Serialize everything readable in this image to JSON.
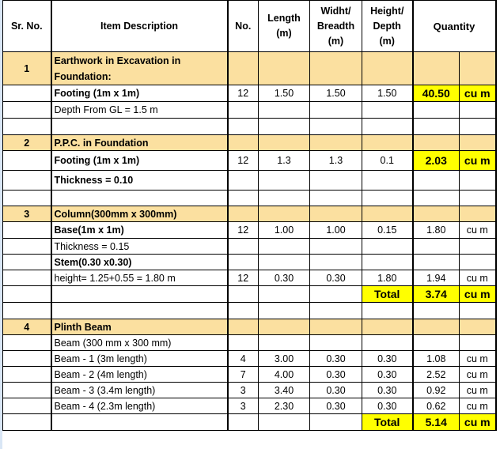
{
  "header": {
    "sr_no": "Sr. No.",
    "item_description": "Item Description",
    "no": "No.",
    "length": "Length (m)",
    "width": "Widht/ Breadth (m)",
    "height": "Height/ Depth (m)",
    "quantity": "Quantity"
  },
  "colors": {
    "section_fill": "#fbe0a0",
    "highlight": "#ffff00"
  },
  "sections": [
    {
      "sr": "1",
      "title": "Earthwork in Excavation in Foundation:",
      "rows": [
        {
          "desc": "Footing (1m x 1m)",
          "bold": true,
          "no": "12",
          "length": "1.50",
          "width": "1.50",
          "height": "1.50",
          "qty": "40.50",
          "unit": "cu m",
          "highlight": true
        },
        {
          "desc": "Depth From GL = 1.5 m",
          "bold": false,
          "no": "",
          "length": "",
          "width": "",
          "height": "",
          "qty": "",
          "unit": ""
        }
      ]
    },
    {
      "sr": "2",
      "title": "P.P.C. in Foundation",
      "rows": [
        {
          "desc": "Footing (1m x 1m)",
          "bold": true,
          "no": "12",
          "length": "1.3",
          "width": "1.3",
          "height": "0.1",
          "qty": "2.03",
          "unit": "cu m",
          "highlight": true
        },
        {
          "desc": "Thickness = 0.10",
          "bold": true,
          "no": "",
          "length": "",
          "width": "",
          "height": "",
          "qty": "",
          "unit": ""
        }
      ]
    },
    {
      "sr": "3",
      "title": "Column(300mm x 300mm)",
      "rows": [
        {
          "desc": "Base(1m x 1m)",
          "bold": true,
          "no": "12",
          "length": "1.00",
          "width": "1.00",
          "height": "0.15",
          "qty": "1.80",
          "unit": "cu m"
        },
        {
          "desc": "Thickness = 0.15",
          "bold": false,
          "no": "",
          "length": "",
          "width": "",
          "height": "",
          "qty": "",
          "unit": ""
        },
        {
          "desc": "Stem(0.30 x0.30)",
          "bold": true,
          "no": "",
          "length": "",
          "width": "",
          "height": "",
          "qty": "",
          "unit": ""
        },
        {
          "desc": "height= 1.25+0.55 = 1.80  m",
          "bold": false,
          "no": "12",
          "length": "0.30",
          "width": "0.30",
          "height": "1.80",
          "qty": "1.94",
          "unit": "cu m"
        }
      ],
      "total": {
        "label": "Total",
        "qty": "3.74",
        "unit": "cu m"
      }
    },
    {
      "sr": "4",
      "title": "Plinth Beam",
      "rows": [
        {
          "desc": "Beam (300 mm x 300 mm)",
          "bold": false,
          "no": "",
          "length": "",
          "width": "",
          "height": "",
          "qty": "",
          "unit": ""
        },
        {
          "desc": "Beam - 1 (3m length)",
          "bold": false,
          "no": "4",
          "length": "3.00",
          "width": "0.30",
          "height": "0.30",
          "qty": "1.08",
          "unit": "cu m"
        },
        {
          "desc": "Beam - 2 (4m length)",
          "bold": false,
          "no": "7",
          "length": "4.00",
          "width": "0.30",
          "height": "0.30",
          "qty": "2.52",
          "unit": "cu m"
        },
        {
          "desc": "Beam - 3 (3.4m length)",
          "bold": false,
          "no": "3",
          "length": "3.40",
          "width": "0.30",
          "height": "0.30",
          "qty": "0.92",
          "unit": "cu m"
        },
        {
          "desc": "Beam - 4 (2.3m length)",
          "bold": false,
          "no": "3",
          "length": "2.30",
          "width": "0.30",
          "height": "0.30",
          "qty": "0.62",
          "unit": "cu m"
        }
      ],
      "total": {
        "label": "Total",
        "qty": "5.14",
        "unit": "cu m"
      }
    }
  ]
}
